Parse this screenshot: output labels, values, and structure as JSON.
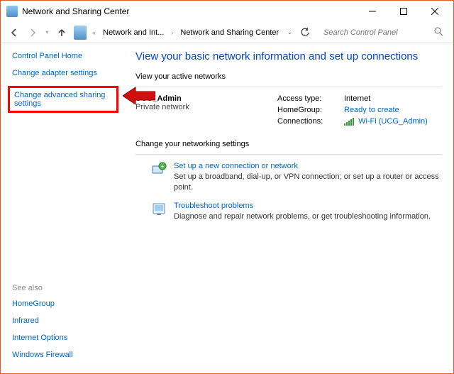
{
  "window": {
    "title": "Network and Sharing Center"
  },
  "breadcrumb": {
    "item1": "Network and Int...",
    "item2": "Network and Sharing Center"
  },
  "search": {
    "placeholder": "Search Control Panel"
  },
  "sidebar": {
    "home": "Control Panel Home",
    "adapter": "Change adapter settings",
    "advanced": "Change advanced sharing settings"
  },
  "seeAlso": {
    "heading": "See also",
    "items": [
      "HomeGroup",
      "Infrared",
      "Internet Options",
      "Windows Firewall"
    ]
  },
  "main": {
    "title": "View your basic network information and set up connections",
    "activeHeading": "View your active networks",
    "network": {
      "name": "UCG_Admin",
      "type": "Private network",
      "accessLabel": "Access type:",
      "accessValue": "Internet",
      "homeLabel": "HomeGroup:",
      "homeValue": "Ready to create",
      "connLabel": "Connections:",
      "connValue": "Wi-Fi (UCG_Admin)"
    },
    "changeHeading": "Change your networking settings",
    "setup": {
      "title": "Set up a new connection or network",
      "desc": "Set up a broadband, dial-up, or VPN connection; or set up a router or access point."
    },
    "trouble": {
      "title": "Troubleshoot problems",
      "desc": "Diagnose and repair network problems, or get troubleshooting information."
    }
  }
}
